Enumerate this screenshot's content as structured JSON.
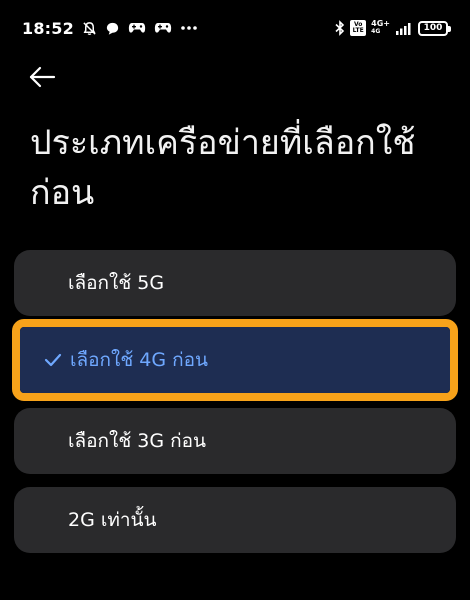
{
  "status_bar": {
    "time": "18:52",
    "net_type_top": "4G+",
    "net_type_bottom": "4G",
    "volte_top": "Vo",
    "volte_bottom": "LTE",
    "battery": "100",
    "icons": [
      "silent-bell-icon",
      "chat-bubble-icon",
      "game-controller-icon",
      "game-controller-icon",
      "more-dots-icon",
      "bluetooth-icon",
      "volte-icon",
      "signal-icon",
      "battery-icon"
    ]
  },
  "header": {
    "back_icon": "back-arrow-icon",
    "title": "ประเภทเครือข่ายที่เลือกใช้ก่อน"
  },
  "options": [
    {
      "label": "เลือกใช้ 5G",
      "selected": false
    },
    {
      "label": "เลือกใช้ 4G ก่อน",
      "selected": true
    },
    {
      "label": "เลือกใช้ 3G ก่อน",
      "selected": false
    },
    {
      "label": "2G เท่านั้น",
      "selected": false
    }
  ],
  "colors": {
    "background": "#000000",
    "option_bg": "#2a2a2c",
    "selected_bg": "#1e2d52",
    "selected_text": "#6fa8ff",
    "highlight": "#f7a21a"
  }
}
